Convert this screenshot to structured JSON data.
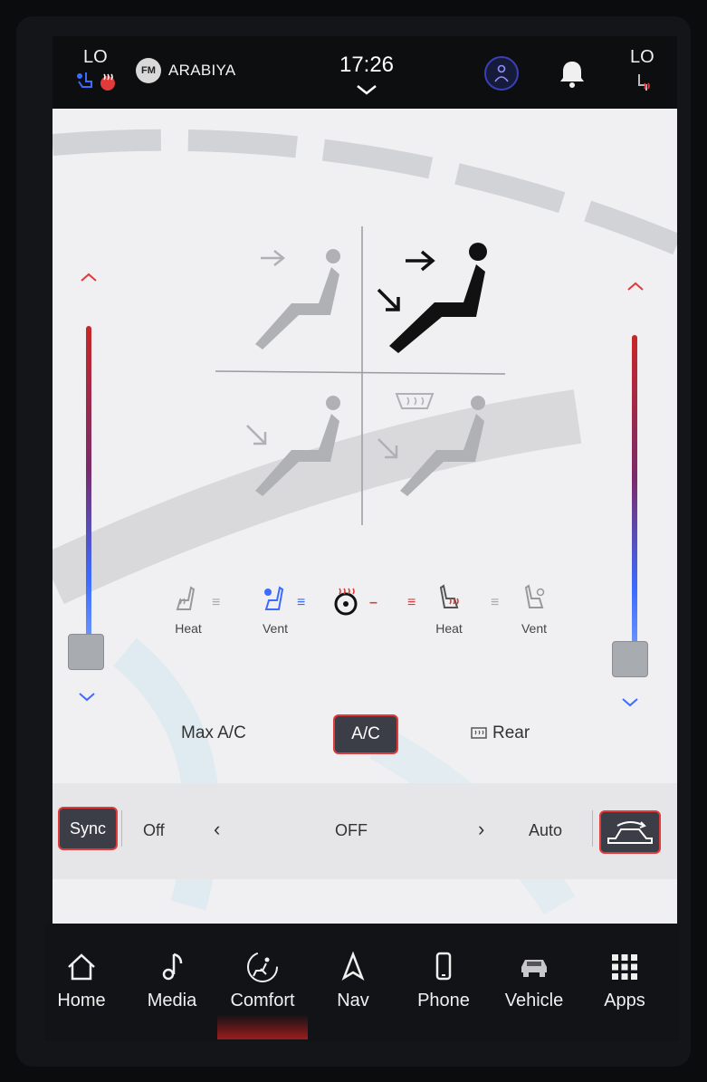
{
  "status_bar": {
    "left_temp": "LO",
    "radio_badge": "FM",
    "station": "ARABIYA",
    "time": "17:26",
    "right_temp": "LO",
    "icons": [
      "seat-fan-icon",
      "seat-heat-icon",
      "driver-assist-icon",
      "bell-icon",
      "seat-heat-icon"
    ]
  },
  "climate": {
    "airflow_modes": [
      {
        "name": "panel",
        "active": false
      },
      {
        "name": "bi-level",
        "active": true
      },
      {
        "name": "floor",
        "active": false
      },
      {
        "name": "floor-defrost",
        "active": false
      }
    ],
    "left_temp_level": 0,
    "right_temp_level": 0,
    "seat_controls": {
      "driver_heat": "Heat",
      "driver_vent": "Vent",
      "passenger_heat": "Heat",
      "passenger_vent": "Vent"
    },
    "buttons": {
      "max_ac": "Max A/C",
      "ac": "A/C",
      "rear": "Rear"
    },
    "fan": {
      "sync": "Sync",
      "off": "Off",
      "prev": "‹",
      "value": "OFF",
      "next": "›",
      "auto": "Auto"
    }
  },
  "nav": {
    "items": [
      {
        "label": "Home",
        "icon": "home-icon"
      },
      {
        "label": "Media",
        "icon": "music-note-icon"
      },
      {
        "label": "Comfort",
        "icon": "comfort-icon",
        "active": true
      },
      {
        "label": "Nav",
        "icon": "navigation-arrow-icon"
      },
      {
        "label": "Phone",
        "icon": "phone-icon"
      },
      {
        "label": "Vehicle",
        "icon": "vehicle-icon"
      },
      {
        "label": "Apps",
        "icon": "apps-grid-icon"
      }
    ]
  },
  "colors": {
    "accent_red": "#e03a3a",
    "cool_blue": "#3b6bff",
    "active_button_bg": "#3b3d47"
  }
}
